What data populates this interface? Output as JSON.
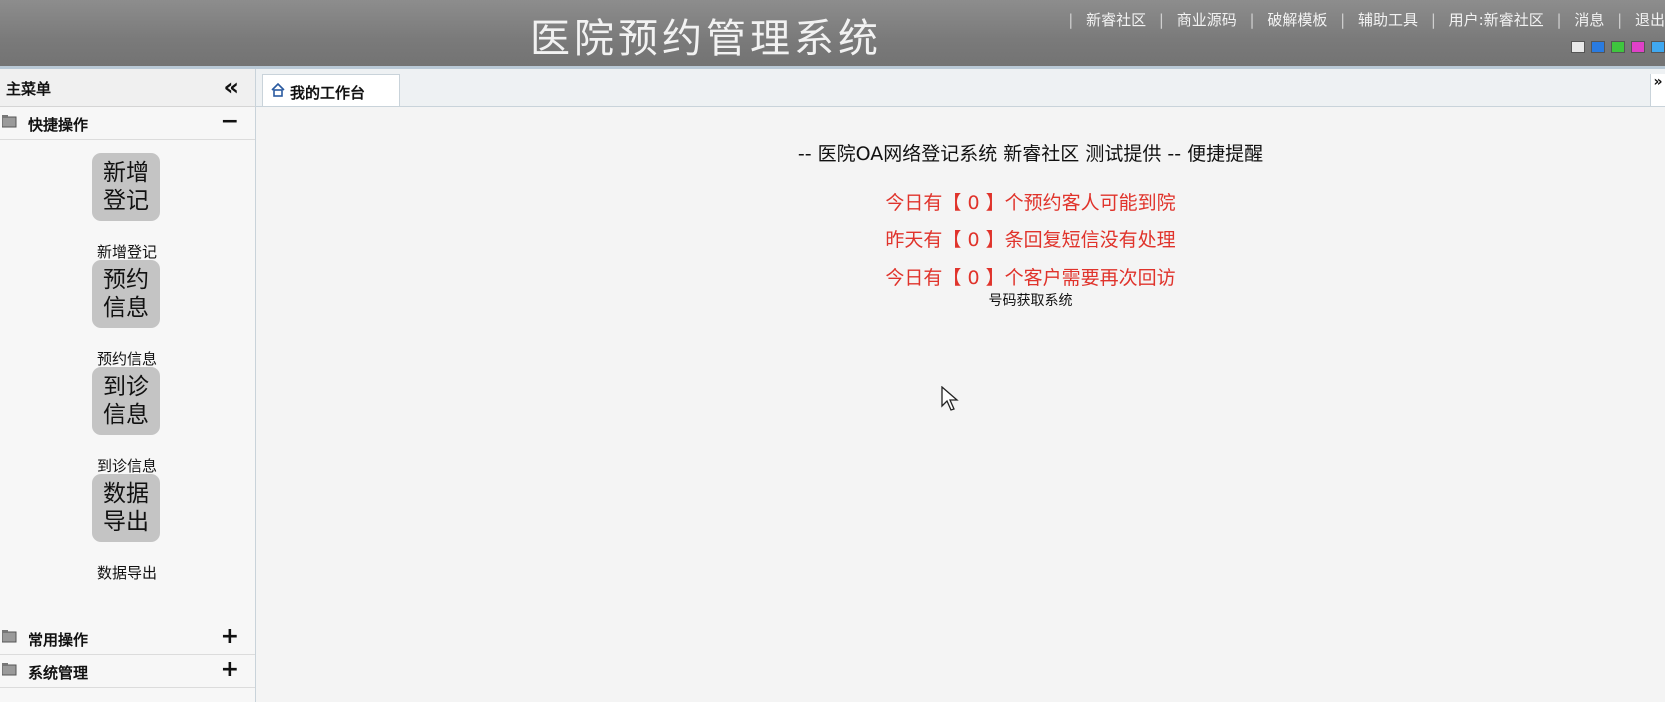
{
  "header": {
    "title": "医院预约管理系统",
    "links": [
      "新睿社区",
      "商业源码",
      "破解模板",
      "辅助工具",
      "用户:新睿社区",
      "消息",
      "退出"
    ],
    "skin_colors": [
      "#e8e8e8",
      "#2a7be0",
      "#3ec63e",
      "#e040c8",
      "#40a8f0"
    ]
  },
  "sidebar": {
    "title": "主菜单",
    "collapse_glyph": "«",
    "groups": [
      {
        "label": "快捷操作",
        "toggle": "−",
        "icon": "folder-icon"
      },
      {
        "label": "常用操作",
        "toggle": "+",
        "icon": "folder-icon"
      },
      {
        "label": "系统管理",
        "toggle": "+",
        "icon": "folder-icon"
      }
    ],
    "quick_items": [
      {
        "line1": "新增",
        "line2": "登记",
        "caption": "新增登记"
      },
      {
        "line1": "预约",
        "line2": "信息",
        "caption": "预约信息"
      },
      {
        "line1": "到诊",
        "line2": "信息",
        "caption": "到诊信息"
      },
      {
        "line1": "数据",
        "line2": "导出",
        "caption": "数据导出"
      }
    ]
  },
  "tabs": [
    {
      "label": "我的工作台",
      "icon": "home-icon"
    }
  ],
  "tab_scroll_glyph": "»",
  "main": {
    "notice_title": "-- 医院OA网络登记系统 新睿社区 测试提供 -- 便捷提醒",
    "alerts": [
      "今日有【 0 】个预约客人可能到院",
      "昨天有【 0 】条回复短信没有处理",
      "今日有【 0 】个客户需要再次回访"
    ],
    "sub_link": "号码获取系统"
  },
  "colors": {
    "alert_red": "#e0332b",
    "header_gray": "#7a7a7a",
    "quick_button_gray": "#c4c4c4"
  }
}
